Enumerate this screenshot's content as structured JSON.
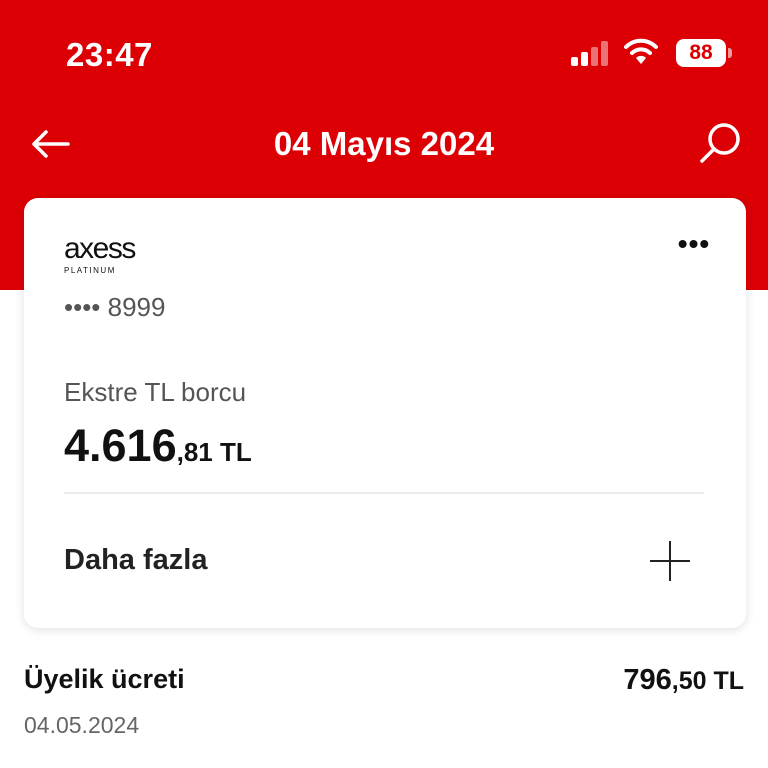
{
  "status_bar": {
    "time": "23:47",
    "battery": "88"
  },
  "header": {
    "title": "04 Mayıs 2024"
  },
  "card": {
    "brand": "axess",
    "tier": "PLATINUM",
    "number_masked": "•••• 8999",
    "statement_label": "Ekstre TL borcu",
    "amount_int": "4.616",
    "amount_dec": ",81 TL",
    "more_label": "Daha fazla"
  },
  "transaction": {
    "title": "Üyelik ücreti",
    "date": "04.05.2024",
    "amount_int": "796",
    "amount_dec": ",50 TL"
  },
  "colors": {
    "brand_red": "#dc0005"
  }
}
